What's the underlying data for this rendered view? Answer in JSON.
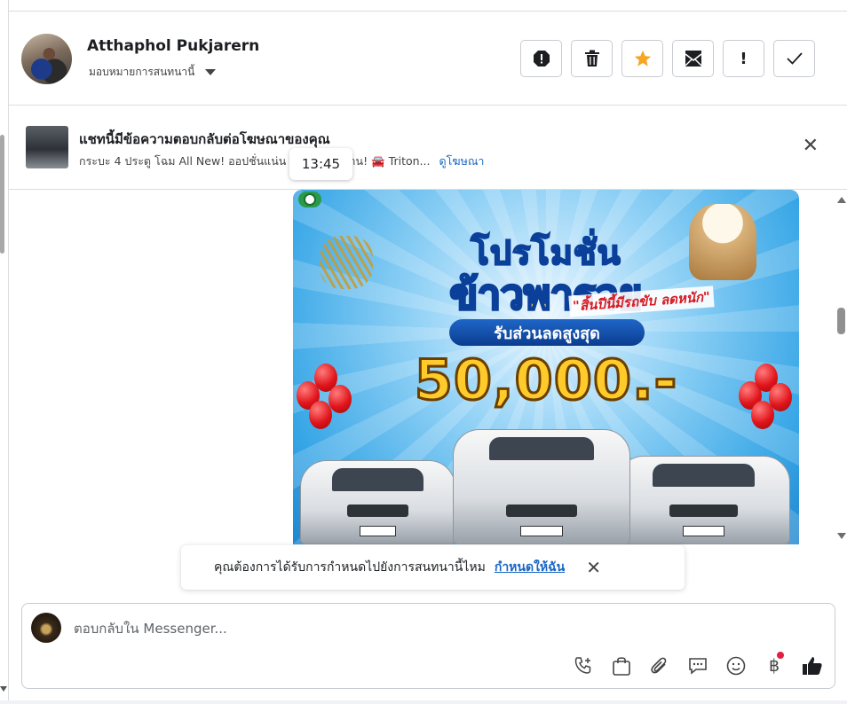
{
  "header": {
    "user_name": "Atthaphol Pukjarern",
    "assign_label": "มอบหมายการสนทนานี้",
    "actions": [
      {
        "name": "spam-button",
        "icon": "alert-octagon-icon"
      },
      {
        "name": "delete-button",
        "icon": "trash-icon"
      },
      {
        "name": "star-button",
        "icon": "star-icon",
        "color": "#f5a623"
      },
      {
        "name": "mark-unread-button",
        "icon": "envelope-icon"
      },
      {
        "name": "follow-up-button",
        "icon": "exclamation-icon"
      },
      {
        "name": "mark-done-button",
        "icon": "check-icon"
      }
    ]
  },
  "ad_banner": {
    "title": "แชทนี้มีข้อความตอบกลับต่อโฆษณาของคุณ",
    "subtitle": "กระบะ 4 ประตู โฉม All New! ออปชั่นแน่น ... พร้อมใช้งาน!",
    "car_text": "Triton...",
    "link": "ดูโฆษณา",
    "time": "13:45"
  },
  "promo_image": {
    "headline_1": "โปรโมชั่น",
    "headline_2": "ข้าวพารวย",
    "tagline": "\"สิ้นปีนี้มีรถขับ ลดหนัก\"",
    "pill": "รับส่วนลดสูงสุด",
    "amount": "50,000.-"
  },
  "suggestion": {
    "text": "คุณต้องการได้รับการกำหนดไปยังการสนทนานี้ไหม",
    "link": "กำหนดให้ฉัน"
  },
  "composer": {
    "placeholder": "ตอบกลับใน Messenger...",
    "tools": [
      "call-plus-icon",
      "shopping-bag-icon",
      "paperclip-icon",
      "chat-bubble-icon",
      "smile-icon",
      "baht-icon",
      "thumbs-up-icon"
    ]
  },
  "colors": {
    "accent": "#1a66c2",
    "star": "#f5a623",
    "badge": "#e41e3f"
  }
}
